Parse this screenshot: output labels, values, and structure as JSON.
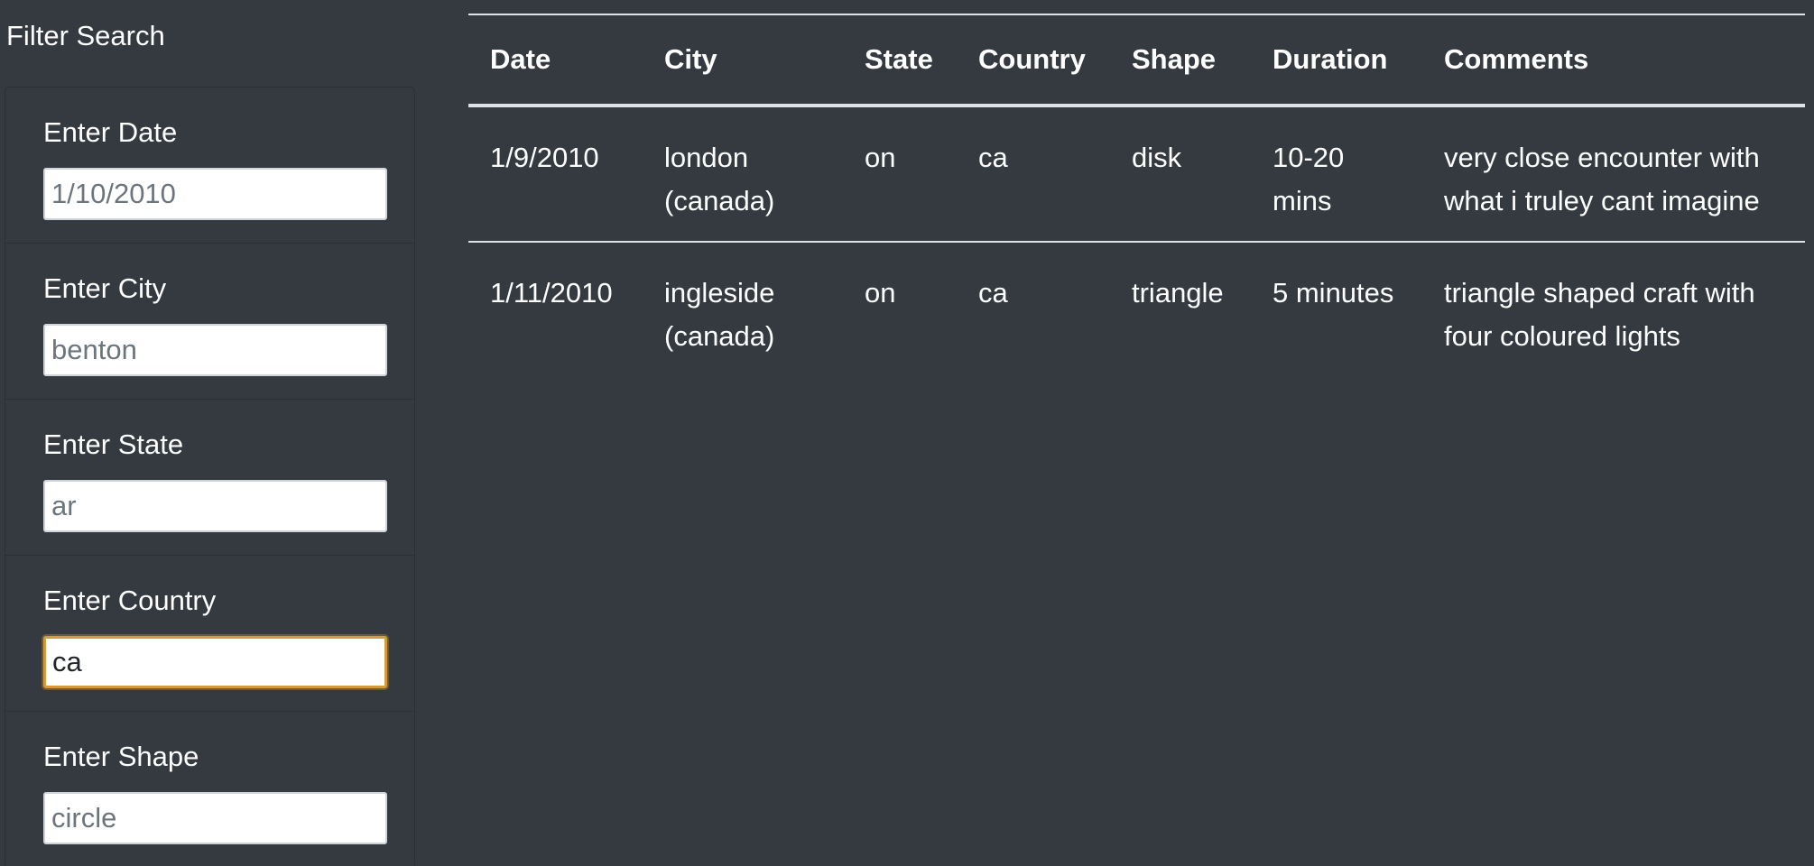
{
  "sidebar": {
    "title": "Filter Search",
    "filters": [
      {
        "label": "Enter Date",
        "placeholder": "1/10/2010",
        "value": ""
      },
      {
        "label": "Enter City",
        "placeholder": "benton",
        "value": ""
      },
      {
        "label": "Enter State",
        "placeholder": "ar",
        "value": ""
      },
      {
        "label": "Enter Country",
        "placeholder": "",
        "value": "ca"
      },
      {
        "label": "Enter Shape",
        "placeholder": "circle",
        "value": ""
      }
    ]
  },
  "table": {
    "headers": [
      "Date",
      "City",
      "State",
      "Country",
      "Shape",
      "Duration",
      "Comments"
    ],
    "rows": [
      [
        "1/9/2010",
        "london (canada)",
        "on",
        "ca",
        "disk",
        "10-20 mins",
        "very close encounter with what i truley cant imagine"
      ],
      [
        "1/11/2010",
        "ingleside (canada)",
        "on",
        "ca",
        "triangle",
        "5 minutes",
        "triangle shaped craft with four coloured lights"
      ]
    ]
  },
  "colors": {
    "background": "#343a40",
    "focus_ring": "#d49a3c",
    "table_rule": "#dee2e6"
  }
}
